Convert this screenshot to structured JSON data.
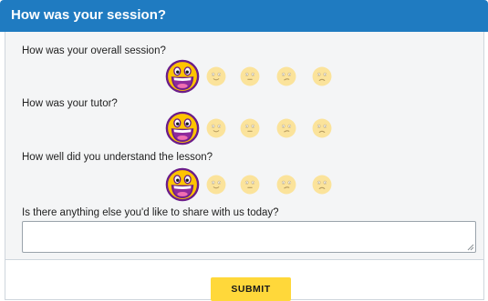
{
  "header": {
    "title": "How was your session?"
  },
  "questions": [
    {
      "label": "How was your overall session?",
      "selected": "very-happy"
    },
    {
      "label": "How was your tutor?",
      "selected": "very-happy"
    },
    {
      "label": "How well did you understand the lesson?",
      "selected": "very-happy"
    }
  ],
  "rating_options": [
    "very-happy",
    "happy",
    "neutral",
    "sad",
    "very-sad"
  ],
  "comment": {
    "label": "Is there anything else you'd like to share with us today?",
    "value": "",
    "placeholder": ""
  },
  "footer": {
    "submit_label": "SUBMIT"
  },
  "colors": {
    "header": "#1f7bc1",
    "submit": "#ffd83a",
    "face_fill": "#fbe39b",
    "face_selected": "#ffc400",
    "face_selected_outline": "#6b1d8a",
    "mouth": "#8e2b9c"
  }
}
